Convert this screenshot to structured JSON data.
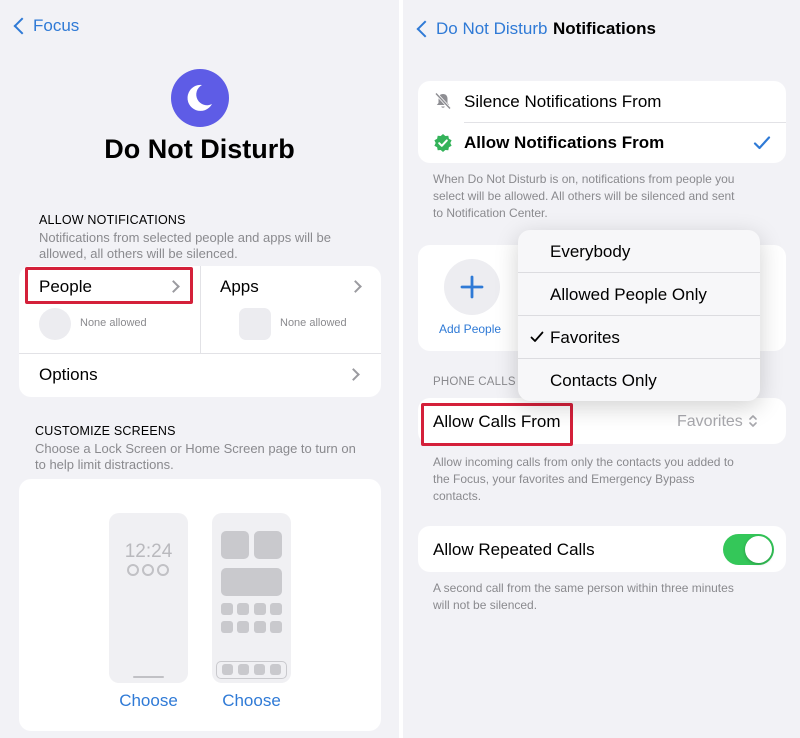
{
  "left": {
    "back_label": "Focus",
    "title": "Do Not Disturb",
    "allow_notifications": {
      "header": "ALLOW NOTIFICATIONS",
      "description_line1": "Notifications from selected people and apps will be",
      "description_line2": "allowed, all others will be silenced.",
      "people_label": "People",
      "people_value": "None allowed",
      "apps_label": "Apps",
      "apps_value": "None allowed",
      "options_label": "Options"
    },
    "customize": {
      "header": "CUSTOMIZE SCREENS",
      "description_line1": "Choose a Lock Screen or Home Screen page to turn on",
      "description_line2": "to help limit distractions.",
      "lock_time": "12:24",
      "choose_lock": "Choose",
      "choose_home": "Choose"
    }
  },
  "right": {
    "back_label": "Do Not Disturb",
    "title": "Notifications",
    "options": {
      "silence_label": "Silence Notifications From",
      "allow_label": "Allow Notifications From",
      "selected": "allow"
    },
    "mode_description_line1": "When Do Not Disturb is on, notifications from people you",
    "mode_description_line2": "select will be allowed. All others will be silenced and sent",
    "mode_description_line3": "to Notification Center.",
    "add_people_label": "Add People",
    "phone_calls_header": "PHONE CALLS",
    "allow_calls_label": "Allow Calls From",
    "allow_calls_value": "Favorites",
    "dropdown": {
      "items": [
        "Everybody",
        "Allowed People Only",
        "Favorites",
        "Contacts Only"
      ],
      "checked": "Favorites"
    },
    "calls_description_line1": "Allow incoming calls from only the contacts you added to",
    "calls_description_line2": "the Focus, your favorites and Emergency Bypass",
    "calls_description_line3": "contacts.",
    "repeated_calls_label": "Allow Repeated Calls",
    "repeated_calls_on": true,
    "repeated_description_line1": "A second call from the same person within three minutes",
    "repeated_description_line2": "will not be silenced."
  },
  "colors": {
    "accent_blue": "#2f7ad6",
    "moon_purple": "#5e5ce6",
    "toggle_green": "#34c759",
    "highlight_red": "#d4203a",
    "allowed_green": "#34b35a"
  },
  "icons": [
    "back-chevron-icon",
    "moon-icon",
    "chevron-right-icon",
    "bell-slash-icon",
    "checkmark-seal-icon",
    "checkmark-icon",
    "plus-icon",
    "up-down-chevron-icon"
  ]
}
